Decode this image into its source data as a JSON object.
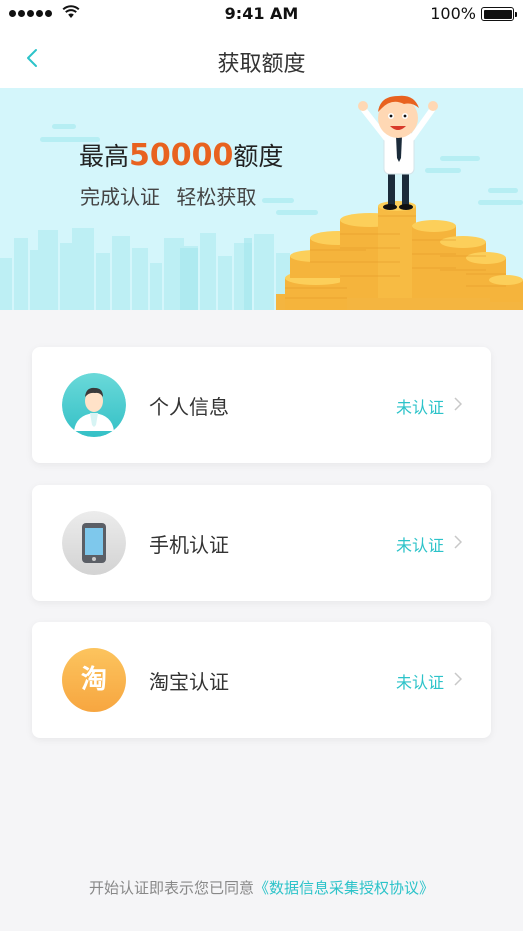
{
  "status_bar": {
    "time": "9:41 AM",
    "battery": "100%"
  },
  "nav": {
    "title": "获取额度"
  },
  "banner": {
    "prefix": "最高",
    "amount": "50000",
    "suffix": "额度",
    "subtitle": "完成认证 轻松获取"
  },
  "items": [
    {
      "label": "个人信息",
      "status": "未认证",
      "icon": "person-icon",
      "color": "#3ec7c9"
    },
    {
      "label": "手机认证",
      "status": "未认证",
      "icon": "phone-icon",
      "color": "#d9d9d9"
    },
    {
      "label": "淘宝认证",
      "status": "未认证",
      "icon": "taobao-icon",
      "icon_char": "淘",
      "color": "#f9b24a"
    }
  ],
  "footer": {
    "text": "开始认证即表示您已同意",
    "link": "《数据信息采集授权协议》"
  },
  "colors": {
    "accent": "#2cc3c9",
    "amount": "#e8621f",
    "banner_bg": "#d4f6fb"
  }
}
